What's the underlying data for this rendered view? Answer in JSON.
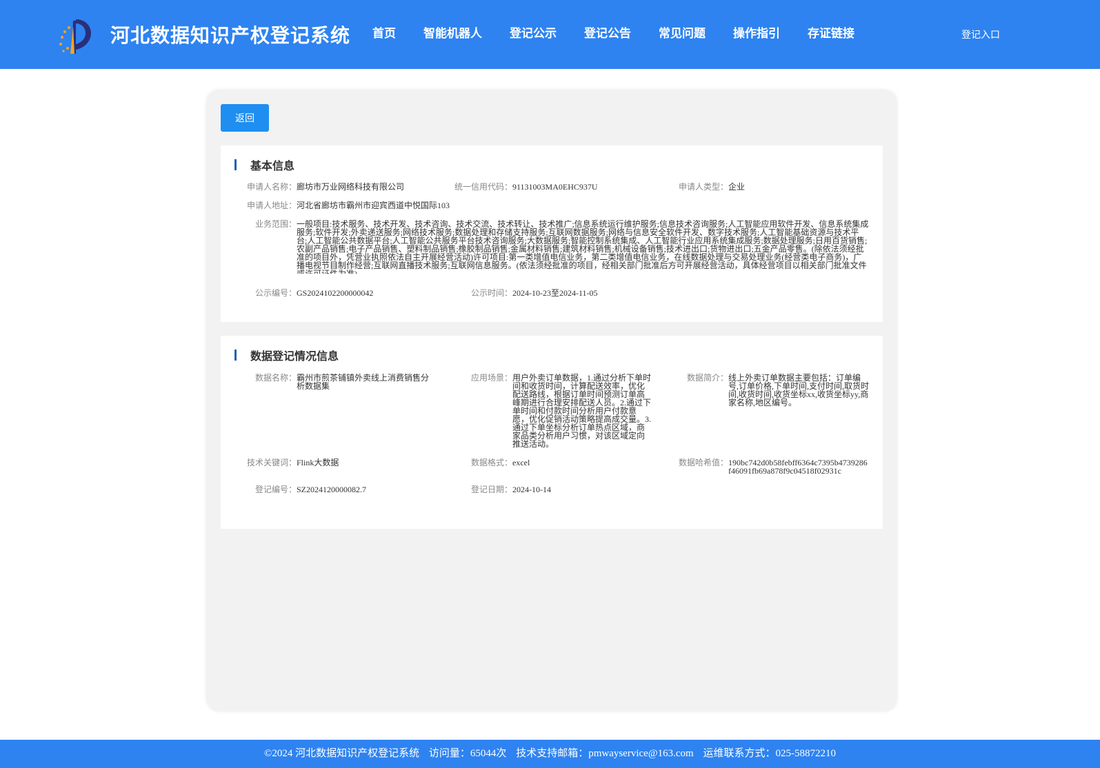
{
  "header": {
    "title": "河北数据知识产权登记系统",
    "nav": [
      "首页",
      "智能机器人",
      "登记公示",
      "登记公告",
      "常见问题",
      "操作指引",
      "存证链接"
    ],
    "login": "登记入口"
  },
  "back_label": "返回",
  "basic": {
    "title": "基本信息",
    "applicant_name_label": "申请人名称：",
    "applicant_name": "廊坊市万业网络科技有限公司",
    "credit_code_label": "统一信用代码：",
    "credit_code": "91131003MA0EHC937U",
    "applicant_type_label": "申请人类型：",
    "applicant_type": "企业",
    "address_label": "申请人地址：",
    "address": "河北省廊坊市霸州市迎宾西道中悦国际103",
    "scope_label": "业务范围：",
    "scope": "一般项目:技术服务、技术开发、技术咨询、技术交流、技术转让、技术推广;信息系统运行维护服务;信息技术咨询服务;人工智能应用软件开发、信息系统集成服务;软件开发;外卖递送服务;网络技术服务;数据处理和存储支持服务;互联网数据服务;网络与信息安全软件开发、数字技术服务;人工智能基础资源与技术平台;人工智能公共数据平台;人工智能公共服务平台技术咨询服务;大数据服务;智能控制系统集成、人工智能行业应用系统集成服务;数据处理服务;日用百货销售;农副产品销售;电子产品销售、塑料制品销售;橡胶制品销售;金属材料销售;建筑材料销售;机械设备销售;技术进出口;货物进出口;五金产品零售。(除依法须经批准的项目外，凭营业执照依法自主开展经营活动)许可项目:第一类增值电信业务，第二类增值电信业务，在线数据处理与交易处理业务(经营类电子商务)，广播电视节目制作经营;互联网直播技术服务;互联网信息服务。(依法须经批准的项目，经相关部门批准后方可开展经营活动，具体经营项目以相关部门批准文件或许可证件为准)",
    "pub_no_label": "公示编号：",
    "pub_no": "GS2024102200000042",
    "pub_time_label": "公示时间：",
    "pub_time": "2024-10-23至2024-11-05"
  },
  "data_info": {
    "title": "数据登记情况信息",
    "data_name_label": "数据名称：",
    "data_name": "霸州市煎茶铺镇外卖线上消费销售分析数据集",
    "scene_label": "应用场景：",
    "scene": "用户外卖订单数据，1.通过分析下单时间和收货时间，计算配送效率，优化配送路线，根据订单时间预测订单高峰期进行合理安排配送人员。2.通过下单时间和付款时间分析用户付款意愿，优化促销活动策略提高成交量。3.通过下单坐标分析订单热点区域，商家品类分析用户习惯，对该区域定向推送活动。",
    "intro_label": "数据简介：",
    "intro": "线上外卖订单数据主要包括：订单编号,订单价格,下单时间,支付时间,取货时间,收货时间,收货坐标xx,收货坐标yy,商家名称,地区编号。",
    "keyword_label": "技术关键词：",
    "keyword": "Flink大数据",
    "format_label": "数据格式：",
    "format": "excel",
    "hash_label": "数据哈希值：",
    "hash": "190bc742d0b58febff6364c7395b4739286f46091fb69a878f9c04518f02931c",
    "reg_no_label": "登记编号：",
    "reg_no": "SZ2024120000082.7",
    "reg_date_label": "登记日期：",
    "reg_date": "2024-10-14"
  },
  "footer": {
    "copyright": "©2024 河北数据知识产权登记系统",
    "visits": "访问量：65044次",
    "email": "技术支持邮箱：pmwayservice@163.com",
    "phone": "运维联系方式：025-58872210"
  },
  "colors": {
    "primary": "#2e83f0",
    "button": "#1f8ef1",
    "title_bar": "#1f5fb3"
  }
}
